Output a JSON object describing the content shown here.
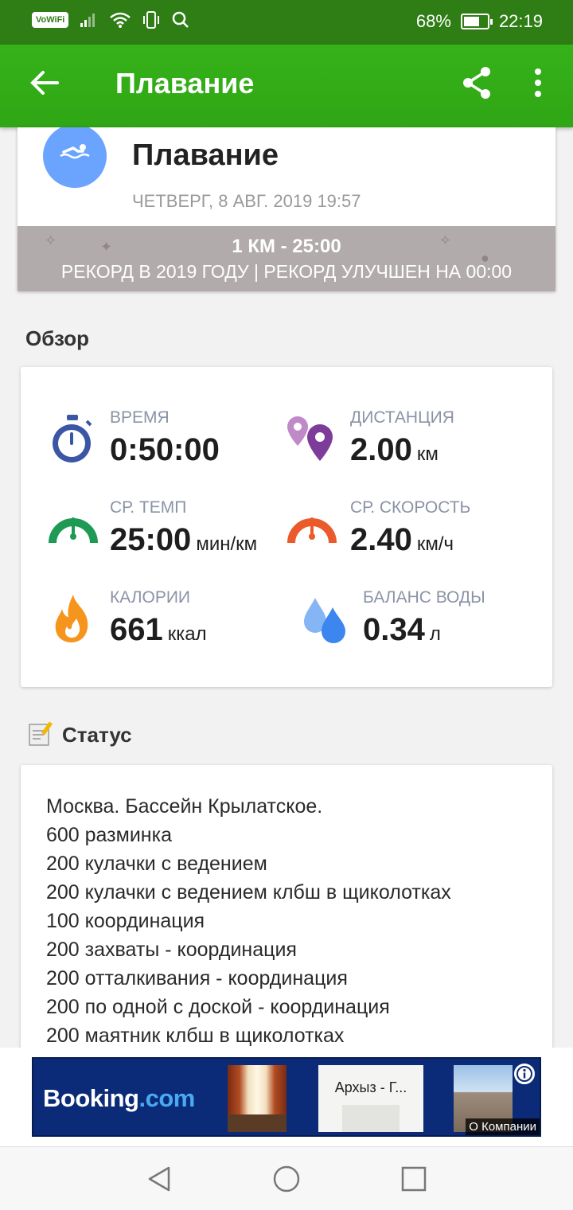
{
  "status_bar": {
    "vowifi": "VoWiFi",
    "battery_percent_label": "68%",
    "battery_level": 0.68,
    "time": "22:19"
  },
  "appbar": {
    "title": "Плавание",
    "icons": [
      "back-arrow-icon",
      "share-icon",
      "more-vert-icon"
    ]
  },
  "activity": {
    "name": "Плавание",
    "date": "ЧЕТВЕРГ, 8 АВГ. 2019 19:57",
    "record_line1": "1 КМ  -  25:00",
    "record_line2": "РЕКОРД В 2019 ГОДУ  |  РЕКОРД УЛУЧШЕН НА 00:00",
    "icon": "swimmer-icon"
  },
  "overview": {
    "title": "Обзор",
    "stats": [
      {
        "label": "ВРЕМЯ",
        "value": "0:50:00",
        "unit": "",
        "icon": "stopwatch-icon"
      },
      {
        "label": "ДИСТАНЦИЯ",
        "value": "2.00",
        "unit": "км",
        "icon": "map-pin-icon"
      },
      {
        "label": "СР. ТЕМП",
        "value": "25:00",
        "unit": "мин/км",
        "icon": "pace-gauge-icon"
      },
      {
        "label": "СР. СКОРОСТЬ",
        "value": "2.40",
        "unit": "км/ч",
        "icon": "speed-gauge-icon"
      },
      {
        "label": "КАЛОРИИ",
        "value": "661",
        "unit": "ккал",
        "icon": "flame-icon"
      },
      {
        "label": "БАЛАНС ВОДЫ",
        "value": "0.34",
        "unit": "л",
        "icon": "water-drops-icon"
      }
    ]
  },
  "status": {
    "title": "Статус",
    "lines": [
      "Москва. Бассейн Крылатское.",
      "600 разминка",
      "200 кулачки с ведением",
      "200 кулачки с ведением клбш в щиколотках",
      "100 координация",
      "200 захваты - координация",
      "200 отталкивания - координация",
      "200 по одной с доской - координация",
      "200 маятник клбш в щиколотках"
    ]
  },
  "ad": {
    "brand": "Booking",
    "brand_suffix": ".com",
    "thumb_caption": "Архыз - Г...",
    "company_label": "О Компании"
  },
  "colors": {
    "appbar": "#2fa615",
    "statusbar": "#2f7d15",
    "record_band": "#b2abab",
    "avatar": "#6aa4ff"
  }
}
